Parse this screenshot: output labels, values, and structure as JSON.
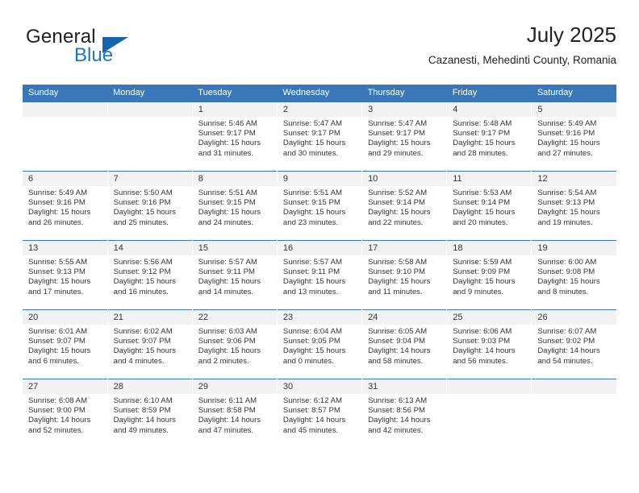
{
  "brand": {
    "name_top": "General",
    "name_bottom": "Blue",
    "triangle_icon": "triangle-icon",
    "color_primary": "#1565ad",
    "color_text": "#231f20"
  },
  "header": {
    "title": "July 2025",
    "subtitle": "Cazanesti, Mehedinti County, Romania"
  },
  "calendar": {
    "header_bg": "#3a77b8",
    "day_band_bg": "#f2f2f2",
    "weekday_names": [
      "Sunday",
      "Monday",
      "Tuesday",
      "Wednesday",
      "Thursday",
      "Friday",
      "Saturday"
    ],
    "weeks": [
      [
        {
          "day": "",
          "sunrise": "",
          "sunset": "",
          "daylight": ""
        },
        {
          "day": "",
          "sunrise": "",
          "sunset": "",
          "daylight": ""
        },
        {
          "day": "1",
          "sunrise": "Sunrise: 5:46 AM",
          "sunset": "Sunset: 9:17 PM",
          "daylight": "Daylight: 15 hours and 31 minutes."
        },
        {
          "day": "2",
          "sunrise": "Sunrise: 5:47 AM",
          "sunset": "Sunset: 9:17 PM",
          "daylight": "Daylight: 15 hours and 30 minutes."
        },
        {
          "day": "3",
          "sunrise": "Sunrise: 5:47 AM",
          "sunset": "Sunset: 9:17 PM",
          "daylight": "Daylight: 15 hours and 29 minutes."
        },
        {
          "day": "4",
          "sunrise": "Sunrise: 5:48 AM",
          "sunset": "Sunset: 9:17 PM",
          "daylight": "Daylight: 15 hours and 28 minutes."
        },
        {
          "day": "5",
          "sunrise": "Sunrise: 5:49 AM",
          "sunset": "Sunset: 9:16 PM",
          "daylight": "Daylight: 15 hours and 27 minutes."
        }
      ],
      [
        {
          "day": "6",
          "sunrise": "Sunrise: 5:49 AM",
          "sunset": "Sunset: 9:16 PM",
          "daylight": "Daylight: 15 hours and 26 minutes."
        },
        {
          "day": "7",
          "sunrise": "Sunrise: 5:50 AM",
          "sunset": "Sunset: 9:16 PM",
          "daylight": "Daylight: 15 hours and 25 minutes."
        },
        {
          "day": "8",
          "sunrise": "Sunrise: 5:51 AM",
          "sunset": "Sunset: 9:15 PM",
          "daylight": "Daylight: 15 hours and 24 minutes."
        },
        {
          "day": "9",
          "sunrise": "Sunrise: 5:51 AM",
          "sunset": "Sunset: 9:15 PM",
          "daylight": "Daylight: 15 hours and 23 minutes."
        },
        {
          "day": "10",
          "sunrise": "Sunrise: 5:52 AM",
          "sunset": "Sunset: 9:14 PM",
          "daylight": "Daylight: 15 hours and 22 minutes."
        },
        {
          "day": "11",
          "sunrise": "Sunrise: 5:53 AM",
          "sunset": "Sunset: 9:14 PM",
          "daylight": "Daylight: 15 hours and 20 minutes."
        },
        {
          "day": "12",
          "sunrise": "Sunrise: 5:54 AM",
          "sunset": "Sunset: 9:13 PM",
          "daylight": "Daylight: 15 hours and 19 minutes."
        }
      ],
      [
        {
          "day": "13",
          "sunrise": "Sunrise: 5:55 AM",
          "sunset": "Sunset: 9:13 PM",
          "daylight": "Daylight: 15 hours and 17 minutes."
        },
        {
          "day": "14",
          "sunrise": "Sunrise: 5:56 AM",
          "sunset": "Sunset: 9:12 PM",
          "daylight": "Daylight: 15 hours and 16 minutes."
        },
        {
          "day": "15",
          "sunrise": "Sunrise: 5:57 AM",
          "sunset": "Sunset: 9:11 PM",
          "daylight": "Daylight: 15 hours and 14 minutes."
        },
        {
          "day": "16",
          "sunrise": "Sunrise: 5:57 AM",
          "sunset": "Sunset: 9:11 PM",
          "daylight": "Daylight: 15 hours and 13 minutes."
        },
        {
          "day": "17",
          "sunrise": "Sunrise: 5:58 AM",
          "sunset": "Sunset: 9:10 PM",
          "daylight": "Daylight: 15 hours and 11 minutes."
        },
        {
          "day": "18",
          "sunrise": "Sunrise: 5:59 AM",
          "sunset": "Sunset: 9:09 PM",
          "daylight": "Daylight: 15 hours and 9 minutes."
        },
        {
          "day": "19",
          "sunrise": "Sunrise: 6:00 AM",
          "sunset": "Sunset: 9:08 PM",
          "daylight": "Daylight: 15 hours and 8 minutes."
        }
      ],
      [
        {
          "day": "20",
          "sunrise": "Sunrise: 6:01 AM",
          "sunset": "Sunset: 9:07 PM",
          "daylight": "Daylight: 15 hours and 6 minutes."
        },
        {
          "day": "21",
          "sunrise": "Sunrise: 6:02 AM",
          "sunset": "Sunset: 9:07 PM",
          "daylight": "Daylight: 15 hours and 4 minutes."
        },
        {
          "day": "22",
          "sunrise": "Sunrise: 6:03 AM",
          "sunset": "Sunset: 9:06 PM",
          "daylight": "Daylight: 15 hours and 2 minutes."
        },
        {
          "day": "23",
          "sunrise": "Sunrise: 6:04 AM",
          "sunset": "Sunset: 9:05 PM",
          "daylight": "Daylight: 15 hours and 0 minutes."
        },
        {
          "day": "24",
          "sunrise": "Sunrise: 6:05 AM",
          "sunset": "Sunset: 9:04 PM",
          "daylight": "Daylight: 14 hours and 58 minutes."
        },
        {
          "day": "25",
          "sunrise": "Sunrise: 6:06 AM",
          "sunset": "Sunset: 9:03 PM",
          "daylight": "Daylight: 14 hours and 56 minutes."
        },
        {
          "day": "26",
          "sunrise": "Sunrise: 6:07 AM",
          "sunset": "Sunset: 9:02 PM",
          "daylight": "Daylight: 14 hours and 54 minutes."
        }
      ],
      [
        {
          "day": "27",
          "sunrise": "Sunrise: 6:08 AM",
          "sunset": "Sunset: 9:00 PM",
          "daylight": "Daylight: 14 hours and 52 minutes."
        },
        {
          "day": "28",
          "sunrise": "Sunrise: 6:10 AM",
          "sunset": "Sunset: 8:59 PM",
          "daylight": "Daylight: 14 hours and 49 minutes."
        },
        {
          "day": "29",
          "sunrise": "Sunrise: 6:11 AM",
          "sunset": "Sunset: 8:58 PM",
          "daylight": "Daylight: 14 hours and 47 minutes."
        },
        {
          "day": "30",
          "sunrise": "Sunrise: 6:12 AM",
          "sunset": "Sunset: 8:57 PM",
          "daylight": "Daylight: 14 hours and 45 minutes."
        },
        {
          "day": "31",
          "sunrise": "Sunrise: 6:13 AM",
          "sunset": "Sunset: 8:56 PM",
          "daylight": "Daylight: 14 hours and 42 minutes."
        },
        {
          "day": "",
          "sunrise": "",
          "sunset": "",
          "daylight": ""
        },
        {
          "day": "",
          "sunrise": "",
          "sunset": "",
          "daylight": ""
        }
      ]
    ]
  }
}
